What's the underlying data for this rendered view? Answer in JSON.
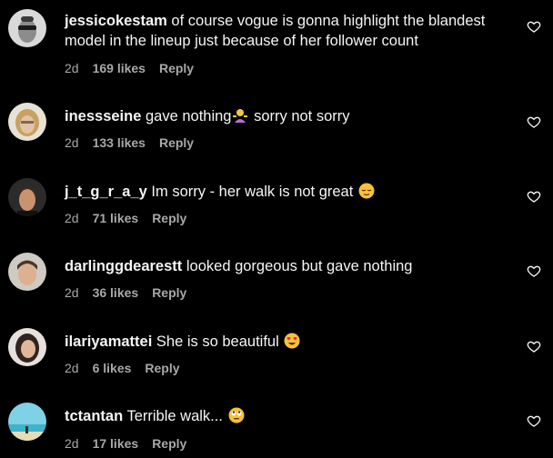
{
  "comments": [
    {
      "username": "jessicokestam",
      "text": "of course vogue is gonna highlight the blandest model in the lineup just because of her follower count",
      "time": "2d",
      "likes": "169 likes",
      "reply": "Reply",
      "avatar_icon": "avatar-sunglasses"
    },
    {
      "username": "inessseine",
      "text_before": "gave nothing",
      "emoji": "person-shrugging-emoji",
      "text_after": "sorry not sorry",
      "time": "2d",
      "likes": "133 likes",
      "reply": "Reply",
      "avatar_icon": "avatar-woman-blonde"
    },
    {
      "username": "j_t_g_r_a_y",
      "text_before": "Im sorry - her walk is not great",
      "emoji": "relieved-face-emoji",
      "time": "2d",
      "likes": "71 likes",
      "reply": "Reply",
      "avatar_icon": "avatar-man"
    },
    {
      "username": "darlinggdearestt",
      "text": "looked gorgeous but gave nothing",
      "time": "2d",
      "likes": "36 likes",
      "reply": "Reply",
      "avatar_icon": "avatar-man-light"
    },
    {
      "username": "ilariyamattei",
      "text_before": "She is so beautiful",
      "emoji": "heart-eyes-emoji",
      "time": "2d",
      "likes": "6 likes",
      "reply": "Reply",
      "avatar_icon": "avatar-woman-dark-hair"
    },
    {
      "username": "tctantan",
      "text_before": "Terrible walk...",
      "emoji": "rolling-eyes-emoji",
      "time": "2d",
      "likes": "17 likes",
      "reply": "Reply",
      "avatar_icon": "avatar-beach"
    }
  ],
  "colors": {
    "background": "#000000",
    "text": "#f5f5f5",
    "secondary": "#a8a8a8"
  }
}
